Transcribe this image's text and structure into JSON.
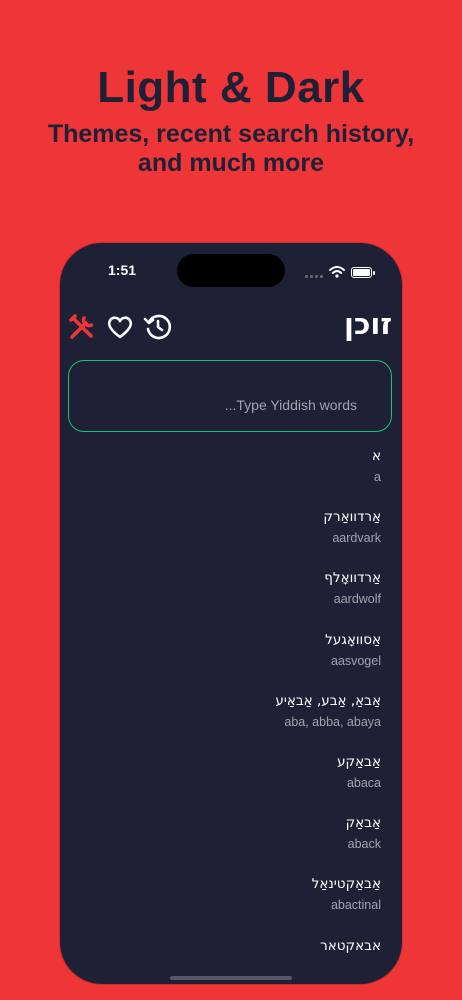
{
  "promo": {
    "headline": "Light & Dark",
    "subhead_line1": "Themes, recent search history,",
    "subhead_line2": "and much more"
  },
  "status_bar": {
    "time": "1:51",
    "icons": [
      "signal-icon",
      "wifi-icon",
      "battery-icon"
    ]
  },
  "app": {
    "title": "זוכן",
    "toolbar": [
      "tools-icon",
      "heart-icon",
      "history-icon"
    ],
    "search": {
      "placeholder": "...Type Yiddish words",
      "value": ""
    }
  },
  "colors": {
    "background": "#EE3537",
    "headline": "#1E2035",
    "phone_bg": "#1E2035",
    "accent_red": "#EE3537",
    "search_border": "#1FBF75",
    "secondary_text": "#A0A3AE"
  },
  "results": [
    {
      "yiddish": "א",
      "english": "a"
    },
    {
      "yiddish": "אַרדוואַרק",
      "english": "aardvark"
    },
    {
      "yiddish": "אַרדוואָלף",
      "english": "aardwolf"
    },
    {
      "yiddish": "אַסוואָגעל",
      "english": "aasvogel"
    },
    {
      "yiddish": "אַבאַ, אַבע, אַבאַיע",
      "english": "aba, abba, abaya"
    },
    {
      "yiddish": "אַבאַקע",
      "english": "abaca"
    },
    {
      "yiddish": "אַבאַק",
      "english": "aback"
    },
    {
      "yiddish": "אַבאַקטינאַל",
      "english": "abactinal"
    },
    {
      "yiddish": "אבאקטאר",
      "english": ""
    }
  ]
}
